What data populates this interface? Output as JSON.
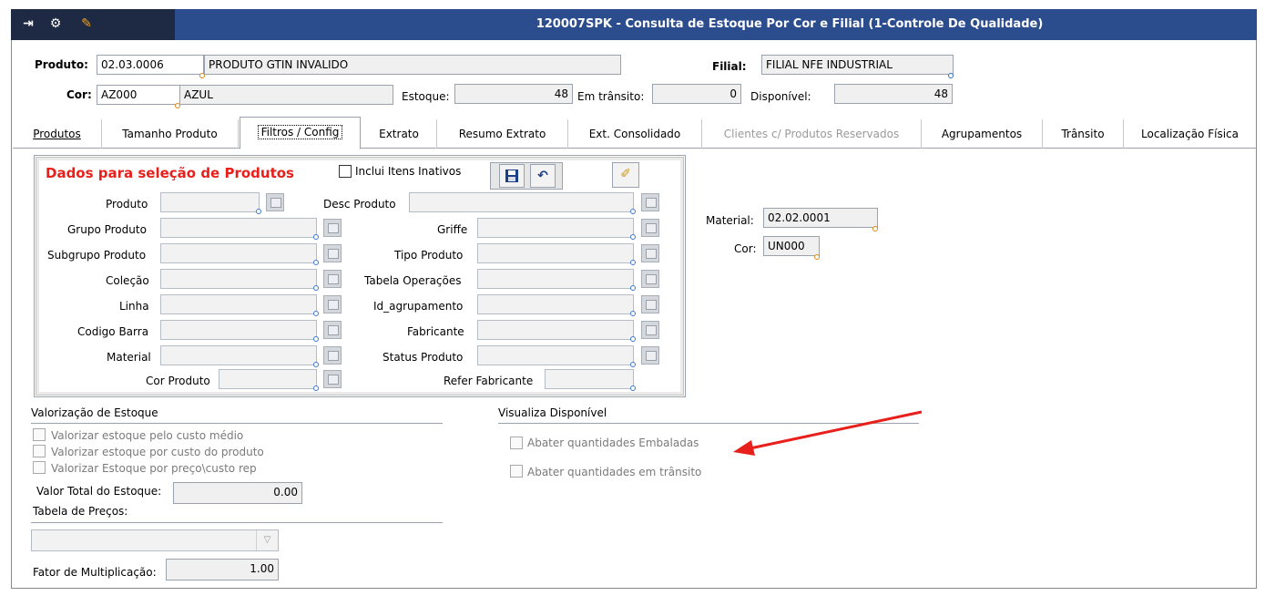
{
  "window": {
    "title": "120007SPK - Consulta de Estoque Por Cor e Filial (1-Controle De Qualidade)",
    "toolbar_icons": [
      "export-icon",
      "settings-icon",
      "wrench-icon"
    ]
  },
  "header": {
    "produto_label": "Produto:",
    "produto_code": "02.03.0006",
    "produto_desc": "PRODUTO GTIN INVALIDO",
    "filial_label": "Filial:",
    "filial_value": "FILIAL NFE INDUSTRIAL",
    "cor_label": "Cor:",
    "cor_code": "AZ000",
    "cor_desc": "AZUL",
    "estoque_label": "Estoque:",
    "estoque_value": "48",
    "transito_label": "Em trânsito:",
    "transito_value": "0",
    "disponivel_label": "Disponível:",
    "disponivel_value": "48"
  },
  "tabs": [
    {
      "label": "Produtos",
      "active": false,
      "disabled": false
    },
    {
      "label": "Tamanho Produto",
      "active": false,
      "disabled": false
    },
    {
      "label": "Filtros / Config",
      "active": true,
      "disabled": false
    },
    {
      "label": "Extrato",
      "active": false,
      "disabled": false
    },
    {
      "label": "Resumo Extrato",
      "active": false,
      "disabled": false
    },
    {
      "label": "Ext. Consolidado",
      "active": false,
      "disabled": false
    },
    {
      "label": "Clientes c/ Produtos Reservados",
      "active": false,
      "disabled": true
    },
    {
      "label": "Agrupamentos",
      "active": false,
      "disabled": false
    },
    {
      "label": "Trânsito",
      "active": false,
      "disabled": false
    },
    {
      "label": "Localização Física",
      "active": false,
      "disabled": false
    }
  ],
  "selection_panel": {
    "title": "Dados para seleção de Produtos",
    "include_inactive_label": "Inclui Itens Inativos",
    "left_fields": [
      "Produto",
      "Grupo Produto",
      "Subgrupo Produto",
      "Coleção",
      "Linha",
      "Codigo Barra",
      "Material",
      "Cor Produto"
    ],
    "right_fields": [
      "Desc Produto",
      "Griffe",
      "Tipo Produto",
      "Tabela Operações",
      "Id_agrupamento",
      "Fabricante",
      "Status Produto",
      "Refer Fabricante"
    ]
  },
  "material_box": {
    "material_label": "Material:",
    "material_value": "02.02.0001",
    "cor_label": "Cor:",
    "cor_value": "UN000"
  },
  "valorizacao": {
    "title": "Valorização de Estoque",
    "options": [
      "Valorizar estoque pelo custo médio",
      "Valorizar estoque por custo do produto",
      "Valorizar Estoque por preço\\custo rep"
    ],
    "valor_total_label": "Valor Total do Estoque:",
    "valor_total_value": "0.00",
    "tabela_precos_label": "Tabela de Preços:",
    "fator_label": "Fator de Multiplicação:",
    "fator_value": "1.00"
  },
  "visualiza": {
    "title": "Visualiza Disponível",
    "options": [
      "Abater quantidades Embaladas",
      "Abater quantidades em trânsito"
    ]
  },
  "colors": {
    "title_bar": "#2b4d8d",
    "panel_title": "#e8201c",
    "annotation_arrow": "#e8201c"
  }
}
